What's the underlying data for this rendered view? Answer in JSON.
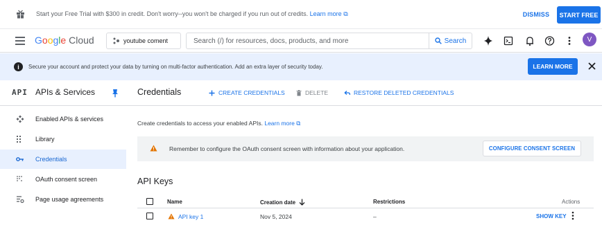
{
  "trial": {
    "message": "Start your Free Trial with $300 in credit. Don't worry--you won't be charged if you run out of credits.",
    "link": "Learn more",
    "dismiss": "DISMISS",
    "start_free": "START FREE"
  },
  "topnav": {
    "logo": {
      "g": "G",
      "o1": "o",
      "o2": "o",
      "g2": "g",
      "l": "l",
      "e": "e",
      "rest": " Cloud"
    },
    "project": "youtube coment",
    "search_placeholder": "Search (/) for resources, docs, products, and more",
    "search_button": "Search",
    "avatar_initial": "V"
  },
  "banner": {
    "text": "Secure your account and protect your data by turning on multi-factor authentication. Add an extra layer of security today.",
    "learn_more": "LEARN MORE"
  },
  "sidebar": {
    "api_label": "API",
    "title": "APIs & Services",
    "items": [
      {
        "label": "Enabled APIs & services",
        "icon": "enabled-apis-icon"
      },
      {
        "label": "Library",
        "icon": "library-icon"
      },
      {
        "label": "Credentials",
        "icon": "key-icon",
        "active": true
      },
      {
        "label": "OAuth consent screen",
        "icon": "oauth-icon"
      },
      {
        "label": "Page usage agreements",
        "icon": "settings-list-icon"
      }
    ]
  },
  "main": {
    "title": "Credentials",
    "actions": {
      "create": "CREATE CREDENTIALS",
      "delete": "DELETE",
      "restore": "RESTORE DELETED CREDENTIALS"
    },
    "intro": "Create credentials to access your enabled APIs.",
    "intro_link": "Learn more",
    "warning": "Remember to configure the OAuth consent screen with information about your application.",
    "configure_button": "CONFIGURE CONSENT SCREEN",
    "api_keys_title": "API Keys",
    "table": {
      "headers": {
        "name": "Name",
        "creation_date": "Creation date",
        "restrictions": "Restrictions",
        "actions": "Actions"
      },
      "rows": [
        {
          "name": "API key 1",
          "creation_date": "Nov 5, 2024",
          "restrictions": "–",
          "action": "SHOW KEY"
        }
      ]
    }
  },
  "colors": {
    "accent": "#1a73e8",
    "banner_bg": "#e8f0fe",
    "warning": "#e37400"
  }
}
